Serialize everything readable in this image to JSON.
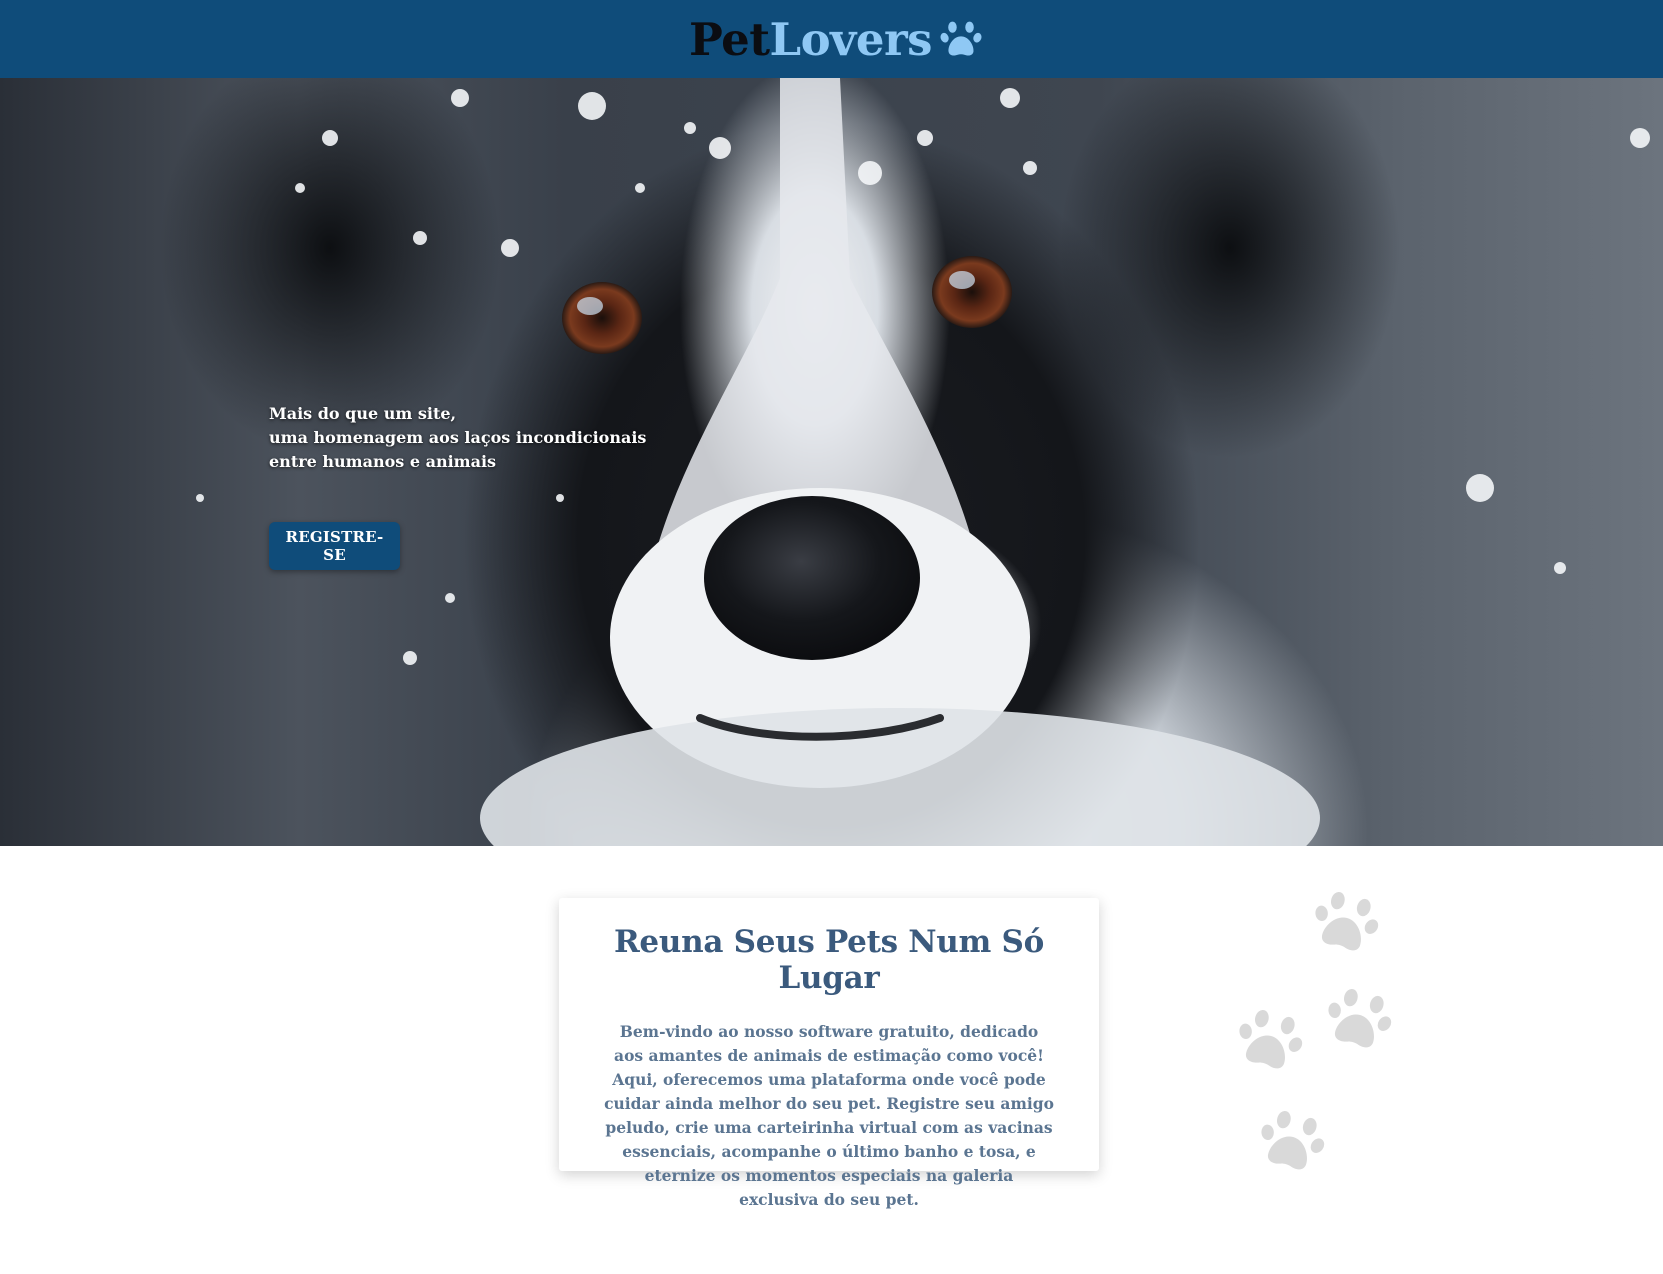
{
  "header": {
    "logo_part1": "Pet",
    "logo_part2": "Lovers",
    "logo_icon": "paw-icon",
    "background_color": "#0f4c7a",
    "logo_accent_color": "#8fc8f4"
  },
  "hero": {
    "image": "black-and-white-dog-with-snow",
    "tagline_lines": [
      "Mais do que um site,",
      "uma homenagem aos laços incondicionais",
      "entre humanos e animais"
    ],
    "register_label": "REGISTRE-SE"
  },
  "info": {
    "title": "Reuna Seus Pets Num Só Lugar",
    "text": "Bem-vindo ao nosso software gratuito, dedicado aos amantes de animais de estimação como você! Aqui, oferecemos uma plataforma onde você pode cuidar ainda melhor do seu pet. Registre seu amigo peludo, crie uma carteirinha virtual com as vacinas essenciais, acompanhe o último banho e tosa, e eternize os momentos especiais na galeria exclusiva do seu pet.",
    "title_color": "#3b5a7d",
    "text_color": "#5b7591"
  },
  "decoration": {
    "icon": "paw-print-icon",
    "count": 4,
    "color": "#d9d9d9"
  }
}
